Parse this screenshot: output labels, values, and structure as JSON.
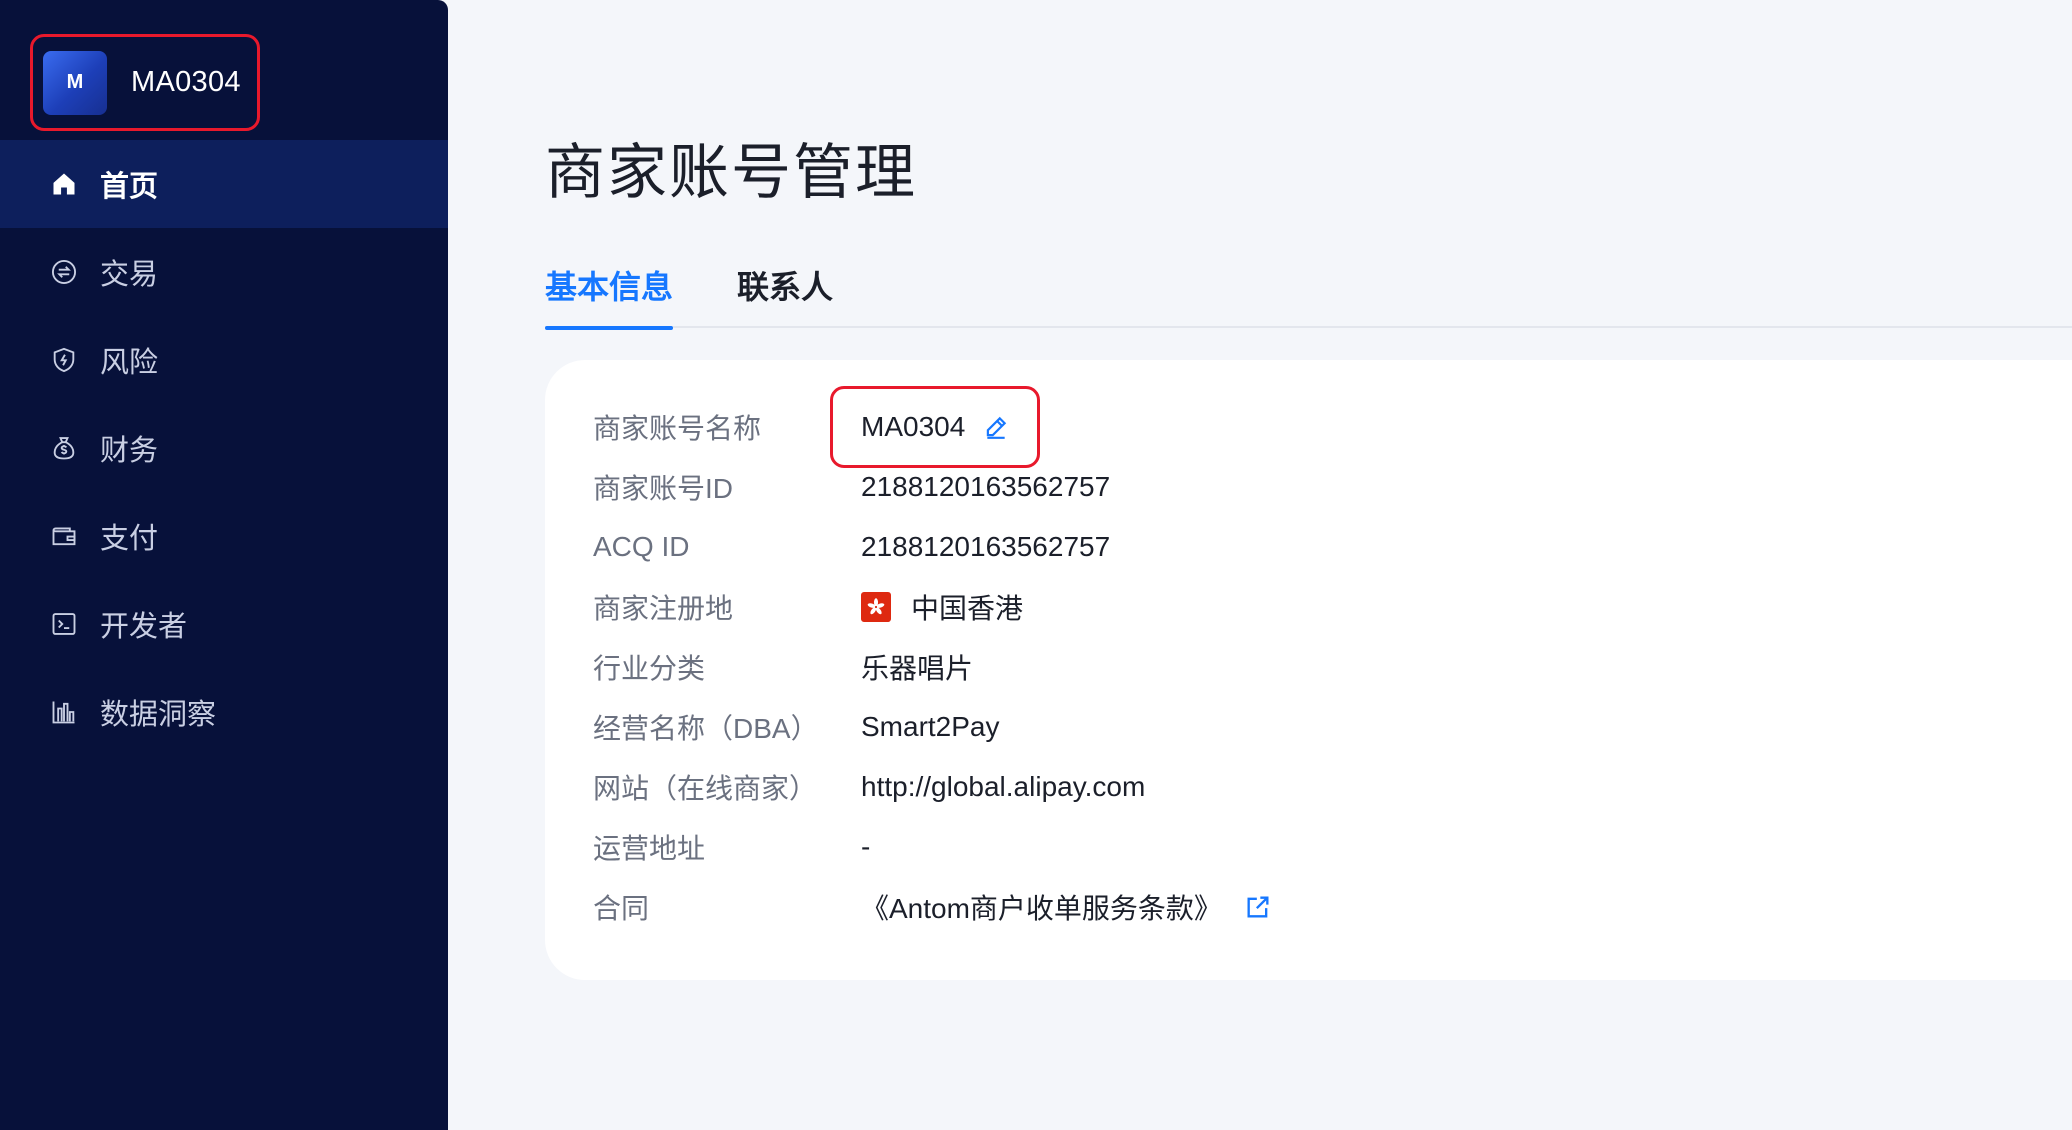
{
  "sidebar": {
    "account": {
      "logo_letter": "M",
      "name": "MA0304"
    },
    "items": [
      {
        "label": "首页",
        "icon": "home-icon",
        "active": true
      },
      {
        "label": "交易",
        "icon": "exchange-icon",
        "active": false
      },
      {
        "label": "风险",
        "icon": "shield-icon",
        "active": false
      },
      {
        "label": "财务",
        "icon": "money-bag-icon",
        "active": false
      },
      {
        "label": "支付",
        "icon": "wallet-icon",
        "active": false
      },
      {
        "label": "开发者",
        "icon": "terminal-icon",
        "active": false
      },
      {
        "label": "数据洞察",
        "icon": "bar-chart-icon",
        "active": false
      }
    ]
  },
  "main": {
    "title": "商家账号管理",
    "tabs": [
      {
        "label": "基本信息",
        "active": true
      },
      {
        "label": "联系人",
        "active": false
      }
    ],
    "info": {
      "merchant_name": {
        "label": "商家账号名称",
        "value": "MA0304"
      },
      "merchant_id": {
        "label": "商家账号ID",
        "value": "2188120163562757"
      },
      "acq_id": {
        "label": "ACQ ID",
        "value": "2188120163562757"
      },
      "region": {
        "label": "商家注册地",
        "value": "中国香港",
        "flag": "hong-kong-flag-icon"
      },
      "industry": {
        "label": "行业分类",
        "value": "乐器唱片"
      },
      "dba": {
        "label": "经营名称（DBA）",
        "value": "Smart2Pay"
      },
      "website": {
        "label": "网站（在线商家）",
        "value": "http://global.alipay.com"
      },
      "address": {
        "label": "运营地址",
        "value": "-"
      },
      "contract": {
        "label": "合同",
        "value": "《Antom商户收单服务条款》"
      }
    }
  },
  "colors": {
    "sidebar_bg": "#07113a",
    "sidebar_active_bg": "#0d1f5c",
    "accent": "#1677ff",
    "highlight_border": "#e8192c",
    "page_bg": "#f4f6fa"
  }
}
